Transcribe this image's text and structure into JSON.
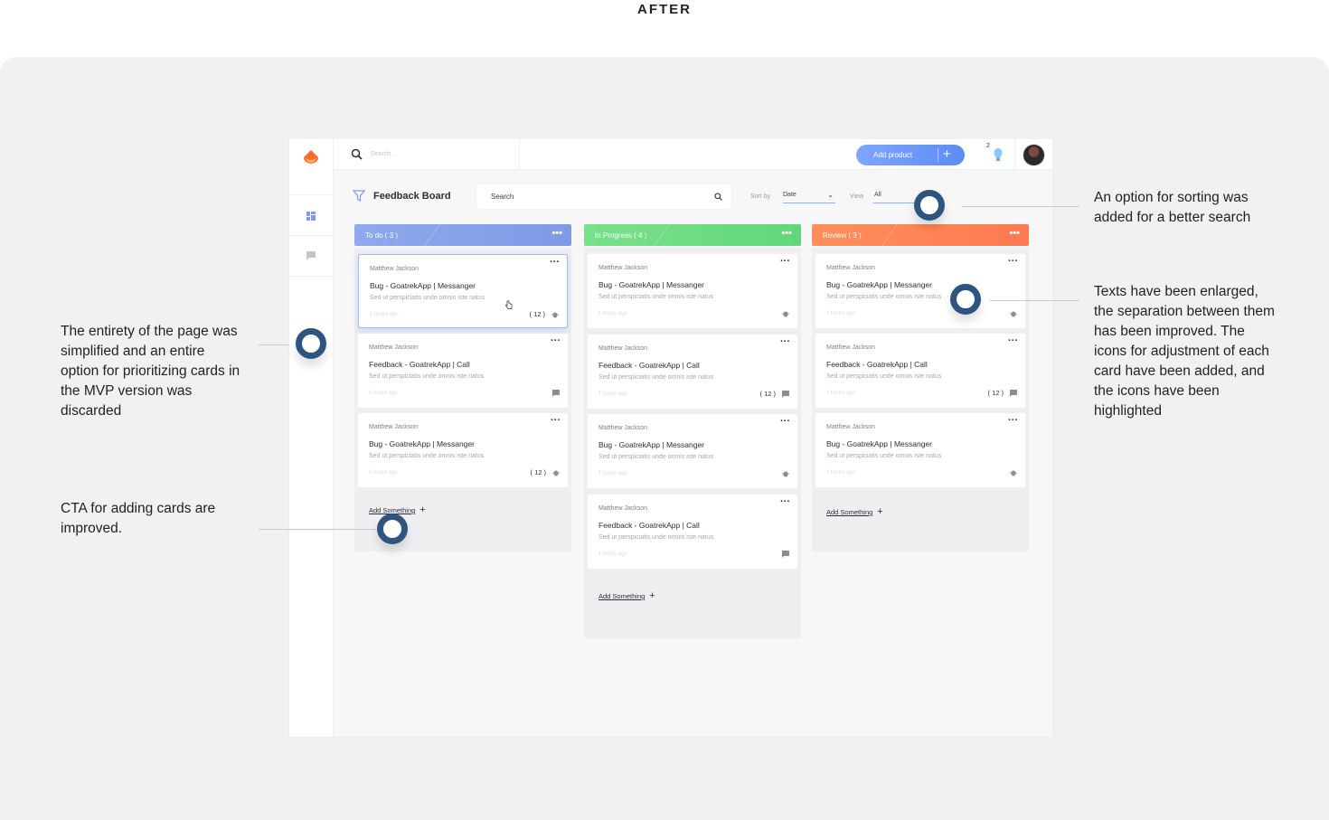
{
  "page_heading": "AFTER",
  "app": {
    "top_search_placeholder": "Search...",
    "add_product_label": "Add product",
    "add_product_plus": "+",
    "notification_count": "2",
    "board_title": "Feedback Board",
    "board_search": "Search",
    "sort_label": "Sort by",
    "sort_value": "Date",
    "view_label": "View",
    "view_value": "All"
  },
  "columns": [
    {
      "title": "To do ( 3 )",
      "color": "#8fa8ee",
      "cards": [
        {
          "author": "Matthew Jackson",
          "title": "Bug - GoatrekApp | Messanger",
          "desc": "Sed ut perspiciatis unde omnis iste natus",
          "time": "1 hours ago",
          "count": "( 12 )",
          "icon": "bug-icon"
        },
        {
          "author": "Matthew Jackson",
          "title": "Feedback - GoatrekApp | Call",
          "desc": "Sed ut perspiciatis unde omnis iste natus",
          "time": "1 hours ago",
          "count": "",
          "icon": "chat-icon"
        },
        {
          "author": "Matthew Jackson",
          "title": "Bug - GoatrekApp | Messanger",
          "desc": "Sed ut perspiciatis unde omnis iste natus",
          "time": "1 hours ago",
          "count": "( 12 )",
          "icon": "bug-icon"
        }
      ],
      "add_label": "Add Something"
    },
    {
      "title": "In Progress ( 4 )",
      "color": "#63d67a",
      "cards": [
        {
          "author": "Matthew Jackson",
          "title": "Bug - GoatrekApp | Messanger",
          "desc": "Sed ut perspiciatis unde omnis iste natus",
          "time": "1 hours ago",
          "count": "",
          "icon": "bug-icon"
        },
        {
          "author": "Matthew Jackson",
          "title": "Feedback - GoatrekApp | Call",
          "desc": "Sed ut perspiciatis unde omnis iste natus",
          "time": "1 hours ago",
          "count": "( 12 )",
          "icon": "chat-icon"
        },
        {
          "author": "Matthew Jackson",
          "title": "Bug - GoatrekApp | Messanger",
          "desc": "Sed ut perspiciatis unde omnis iste natus",
          "time": "1 hours ago",
          "count": "",
          "icon": "bug-icon"
        },
        {
          "author": "Matthew Jackson",
          "title": "Feedback - GoatrekApp | Call",
          "desc": "Sed ut perspiciatis unde omnis iste natus",
          "time": "1 hours ago",
          "count": "",
          "icon": "chat-icon"
        }
      ],
      "add_label": "Add Something"
    },
    {
      "title": "Review ( 3 )",
      "color": "#ff7a52",
      "cards": [
        {
          "author": "Matthew Jackson",
          "title": "Bug - GoatrekApp | Messanger",
          "desc": "Sed ut perspiciatis unde omnis iste natus",
          "time": "1 hours ago",
          "count": "",
          "icon": "bug-icon"
        },
        {
          "author": "Matthew Jackson",
          "title": "Feedback - GoatrekApp | Call",
          "desc": "Sed ut perspiciatis unde omnis iste natus",
          "time": "1 hours ago",
          "count": "( 12 )",
          "icon": "chat-icon"
        },
        {
          "author": "Matthew Jackson",
          "title": "Bug - GoatrekApp | Messanger",
          "desc": "Sed ut perspiciatis unde omnis iste natus",
          "time": "1 hours ago",
          "count": "",
          "icon": "bug-icon"
        }
      ],
      "add_label": "Add Something"
    }
  ],
  "annotations": {
    "left_top": [
      "The entirety of the page was",
      "simplified and an entire",
      "option for prioritizing cards in",
      "the MVP version was",
      "discarded"
    ],
    "left_bottom": [
      "CTA for adding cards are",
      "improved."
    ],
    "right_top": [
      "An option for sorting was",
      "added for a better search"
    ],
    "right_middle": [
      "Texts have been enlarged,",
      "the separation between them",
      "has been improved. The",
      "icons for adjustment of each",
      "card have been added, and",
      "the icons have been",
      "highlighted"
    ]
  },
  "colors": {
    "marker": "#2e5480",
    "accent": "#5d8cf2",
    "logo": "#ff6a2b"
  }
}
